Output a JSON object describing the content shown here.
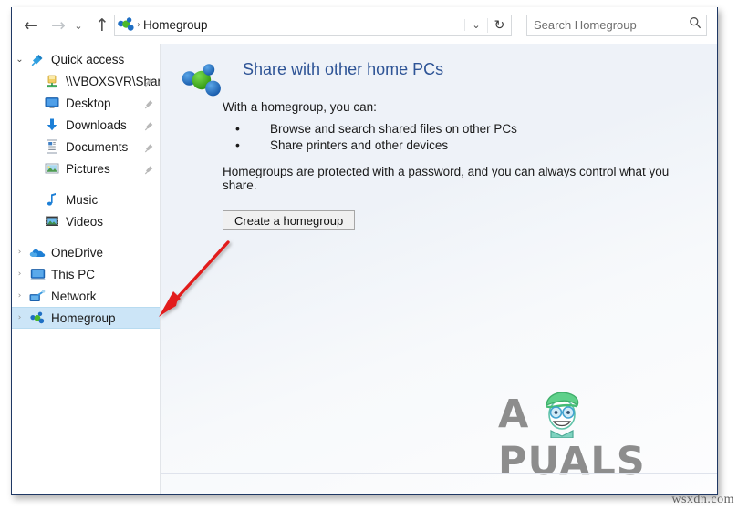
{
  "window": {
    "title": "Homegroup"
  },
  "toolbar": {
    "back_label": "←",
    "forward_label": "→",
    "recent_label": "⌄",
    "up_label": "↑",
    "back_name": "back-button",
    "forward_name": "forward-button",
    "address": {
      "icon": "homegroup-icon",
      "separator": "›",
      "path_text": "Homegroup",
      "dropdown_label": "⌄",
      "refresh_label": "↻"
    },
    "search": {
      "placeholder": "Search Homegroup",
      "value": "",
      "icon": "search-icon"
    }
  },
  "sidebar": {
    "items": [
      {
        "label": "Quick access",
        "icon": "pin-star-icon",
        "twisty": "⌄",
        "expanded": true,
        "indent": false,
        "pinned": false,
        "selected": false
      },
      {
        "label": "\\\\VBOXSVR\\Shar",
        "icon": "network-folder-icon",
        "twisty": "",
        "expanded": false,
        "indent": true,
        "pinned": true,
        "selected": false
      },
      {
        "label": "Desktop",
        "icon": "desktop-icon",
        "twisty": "",
        "expanded": false,
        "indent": true,
        "pinned": true,
        "selected": false
      },
      {
        "label": "Downloads",
        "icon": "downloads-icon",
        "twisty": "",
        "expanded": false,
        "indent": true,
        "pinned": true,
        "selected": false
      },
      {
        "label": "Documents",
        "icon": "documents-icon",
        "twisty": "",
        "expanded": false,
        "indent": true,
        "pinned": true,
        "selected": false
      },
      {
        "label": "Pictures",
        "icon": "pictures-icon",
        "twisty": "",
        "expanded": false,
        "indent": true,
        "pinned": true,
        "selected": false
      },
      {
        "label": "Music",
        "icon": "music-icon",
        "twisty": "",
        "expanded": false,
        "indent": true,
        "pinned": false,
        "selected": false
      },
      {
        "label": "Videos",
        "icon": "videos-icon",
        "twisty": "",
        "expanded": false,
        "indent": true,
        "pinned": false,
        "selected": false
      },
      {
        "label": "OneDrive",
        "icon": "onedrive-cloud-icon",
        "twisty": "›",
        "expanded": false,
        "indent": false,
        "pinned": false,
        "selected": false
      },
      {
        "label": "This PC",
        "icon": "this-pc-icon",
        "twisty": "›",
        "expanded": false,
        "indent": false,
        "pinned": false,
        "selected": false
      },
      {
        "label": "Network",
        "icon": "network-icon",
        "twisty": "›",
        "expanded": false,
        "indent": false,
        "pinned": false,
        "selected": false
      },
      {
        "label": "Homegroup",
        "icon": "homegroup-icon",
        "twisty": "›",
        "expanded": false,
        "indent": false,
        "pinned": false,
        "selected": true
      }
    ]
  },
  "content": {
    "icon": "homegroup-icon",
    "title": "Share with other home PCs",
    "lead": "With a homegroup, you can:",
    "bullets": [
      "Browse and search shared files on other PCs",
      "Share printers and other devices"
    ],
    "note": "Homegroups are protected with a password, and you can always control what you share.",
    "create_button": "Create a homegroup"
  },
  "watermark": {
    "brand_text": "A  PUALS",
    "site_text": "wsxdn.com"
  },
  "annotation": {
    "arrow_color": "#e21b1b",
    "target": "sidebar-item-homegroup"
  },
  "colors": {
    "window_border": "#1f3864",
    "selection": "#cce5f7",
    "title_blue": "#2e5496",
    "content_bg": "#eef2f8",
    "homegroup_green": "#4cb829",
    "homegroup_blue": "#1f6fc4"
  }
}
